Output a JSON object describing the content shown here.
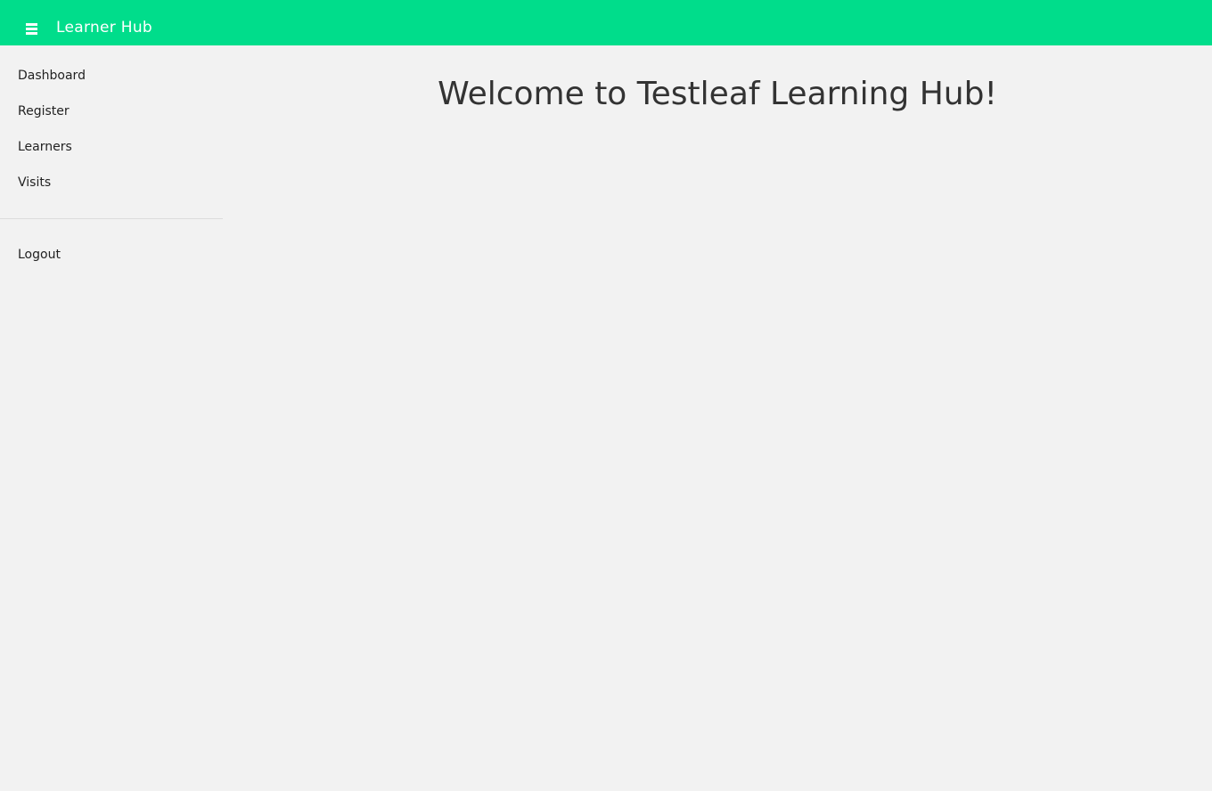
{
  "header": {
    "menu_icon": "hamburger-menu-icon",
    "title": "Learner Hub",
    "background_color": "#00dd8b"
  },
  "sidebar": {
    "items": [
      {
        "label": "Dashboard"
      },
      {
        "label": "Register"
      },
      {
        "label": "Learners"
      },
      {
        "label": "Visits"
      }
    ],
    "logout_label": "Logout"
  },
  "main": {
    "heading": "Welcome to Testleaf Learning Hub!"
  }
}
